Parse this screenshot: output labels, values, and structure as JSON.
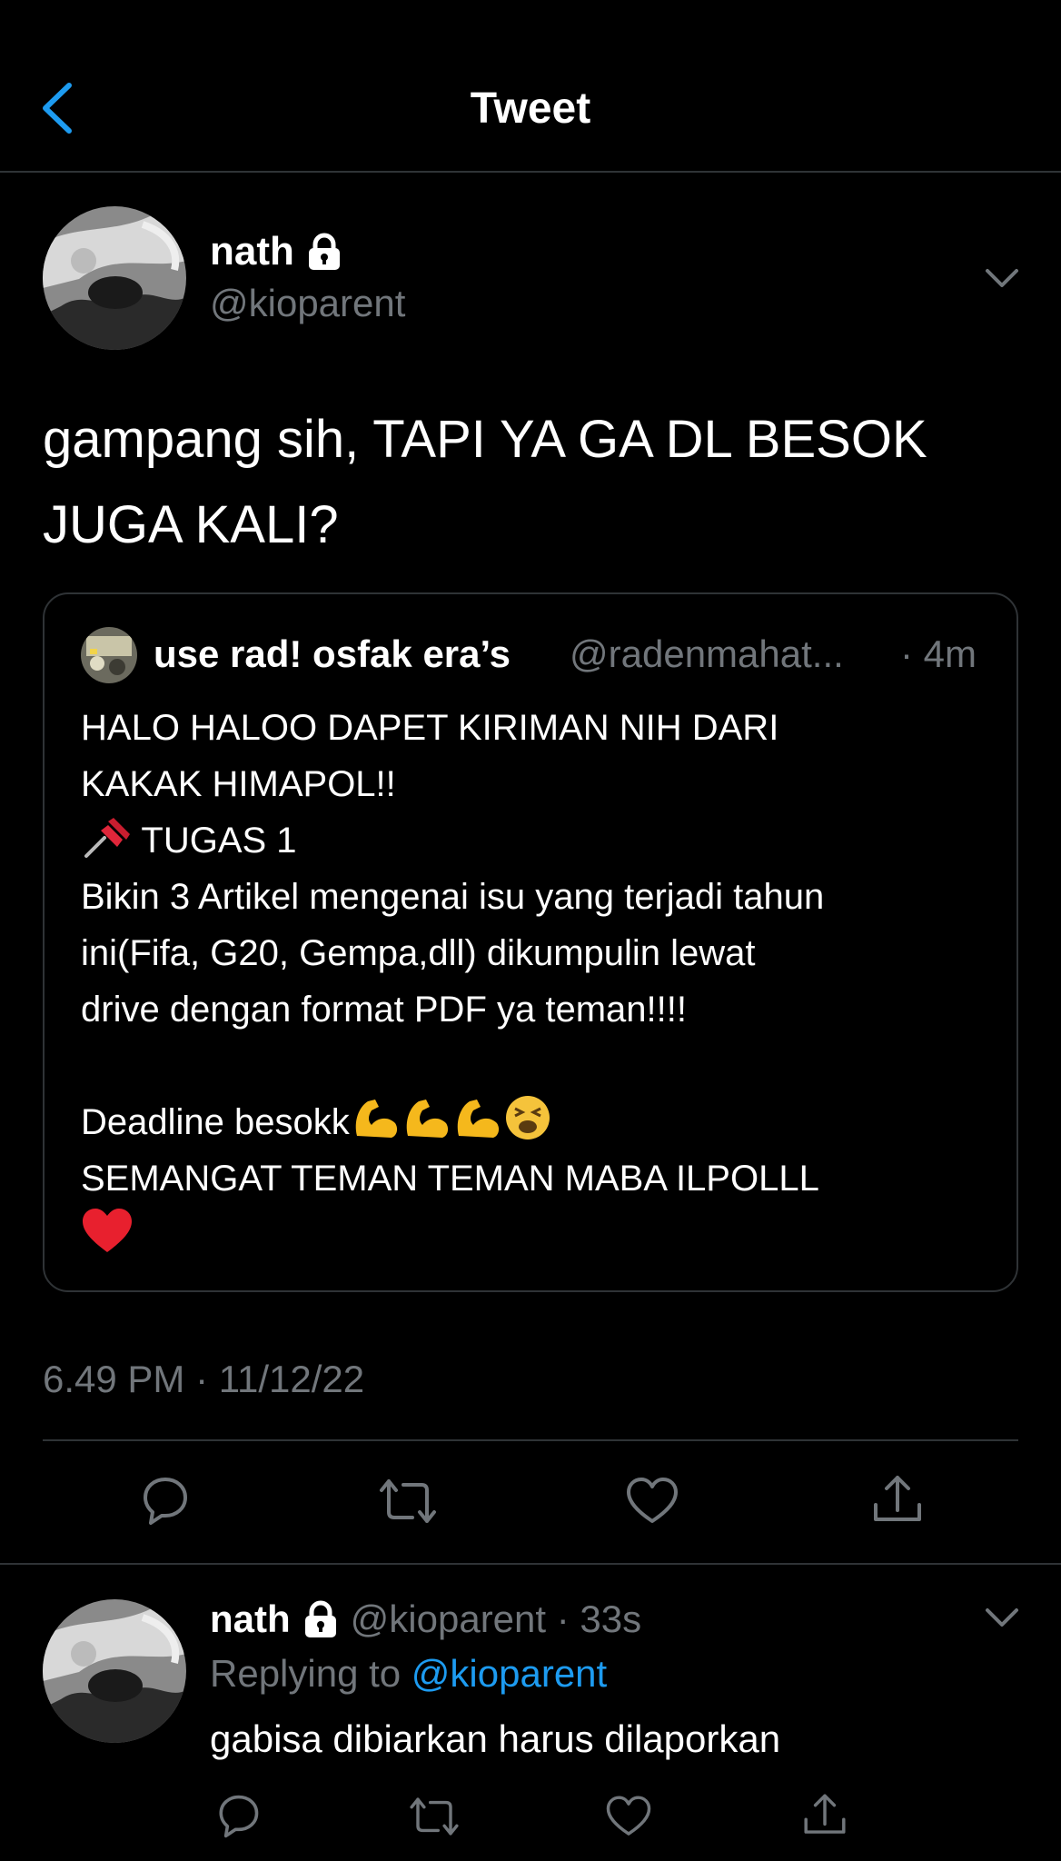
{
  "header": {
    "title": "Tweet",
    "back_icon": "chevron-left-icon",
    "accent": "#1d9bf0"
  },
  "tweet": {
    "author_name": "nath",
    "author_handle": "@kioparent",
    "text_lines": [
      "gampang sih, TAPI YA GA DL BESOK",
      "JUGA KALI?"
    ],
    "timestamp": "6.49 PM · 11/12/22"
  },
  "quote": {
    "name": "use rad! osfak era’s",
    "handle": "@radenmahat...",
    "time": "· 4m",
    "lines": [
      "HALO HALOO DAPET KIRIMAN NIH DARI",
      "KAKAK HIMAPOL!!",
      "TUGAS 1",
      "Bikin 3 Artikel mengenai isu yang terjadi tahun",
      "ini(Fifa, G20, Gempa,dll) dikumpulin lewat",
      "drive dengan format PDF ya teman!!!!",
      "",
      "Deadline besokk",
      "SEMANGAT TEMAN TEMAN MABA ILPOLLL"
    ]
  },
  "actions": [
    "reply-icon",
    "retweet-icon",
    "like-icon",
    "share-icon"
  ],
  "reply": {
    "name": "nath",
    "meta": "@kioparent · 33s",
    "replying_label": "Replying to",
    "replying_to": "@kioparent",
    "text": "gabisa dibiarkan harus dilaporkan"
  }
}
